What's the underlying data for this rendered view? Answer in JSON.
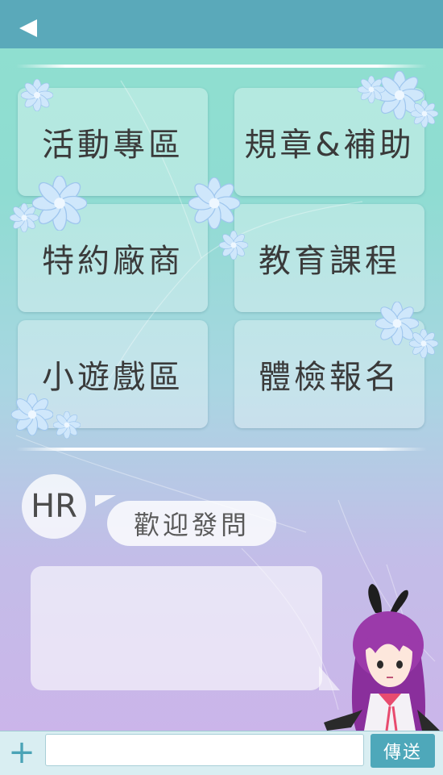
{
  "header": {
    "back_icon": "back-arrow-icon"
  },
  "menu": {
    "tiles": [
      {
        "label": "活動專區"
      },
      {
        "label": "規章&補助"
      },
      {
        "label": "特約廠商"
      },
      {
        "label": "教育課程"
      },
      {
        "label": "小遊戲區"
      },
      {
        "label": "體檢報名"
      }
    ]
  },
  "chat": {
    "avatar_text": "HR",
    "greeting": "歡迎發問",
    "message_text": ""
  },
  "input_bar": {
    "plus_icon": "plus-icon",
    "plus_label": "+",
    "input_value": "",
    "input_placeholder": "",
    "send_label": "傳送"
  },
  "colors": {
    "header": "#5aa9ba",
    "send_button": "#4ea8ba",
    "plus": "#4aa3b6"
  }
}
